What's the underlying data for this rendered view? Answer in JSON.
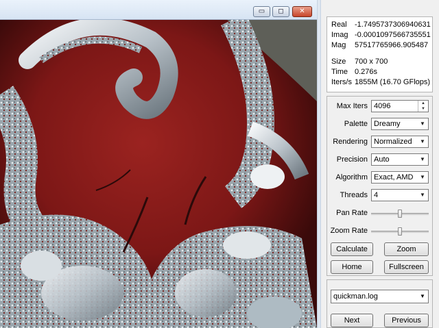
{
  "window": {
    "controls": {
      "minimize": "▭",
      "maximize": "◻",
      "close": "✕"
    }
  },
  "info": {
    "real_label": "Real",
    "real_value": "-1.7495737306940631",
    "imag_label": "Imag",
    "imag_value": "-0.0001097566735551",
    "mag_label": "Mag",
    "mag_value": "57517765966.905487",
    "size_label": "Size",
    "size_value": "700 x 700",
    "time_label": "Time",
    "time_value": "0.276s",
    "iters_label": "Iters/s",
    "iters_value": "1855M (16.70 GFlops)"
  },
  "controls": {
    "max_iters_label": "Max Iters",
    "max_iters_value": "4096",
    "palette_label": "Palette",
    "palette_value": "Dreamy",
    "rendering_label": "Rendering",
    "rendering_value": "Normalized",
    "precision_label": "Precision",
    "precision_value": "Auto",
    "algorithm_label": "Algorithm",
    "algorithm_value": "Exact, AMD",
    "threads_label": "Threads",
    "threads_value": "4",
    "pan_rate_label": "Pan Rate",
    "pan_rate_level": 0.5,
    "zoom_rate_label": "Zoom Rate",
    "zoom_rate_level": 0.5,
    "calculate": "Calculate",
    "zoom": "Zoom",
    "home": "Home",
    "fullscreen": "Fullscreen"
  },
  "log": {
    "file": "quickman.log",
    "next": "Next",
    "previous": "Previous"
  },
  "colors": {
    "fractal_red": "#8a1e1c",
    "fractal_dark": "#2a0a0a",
    "fractal_silver": "#cfd6dc"
  }
}
